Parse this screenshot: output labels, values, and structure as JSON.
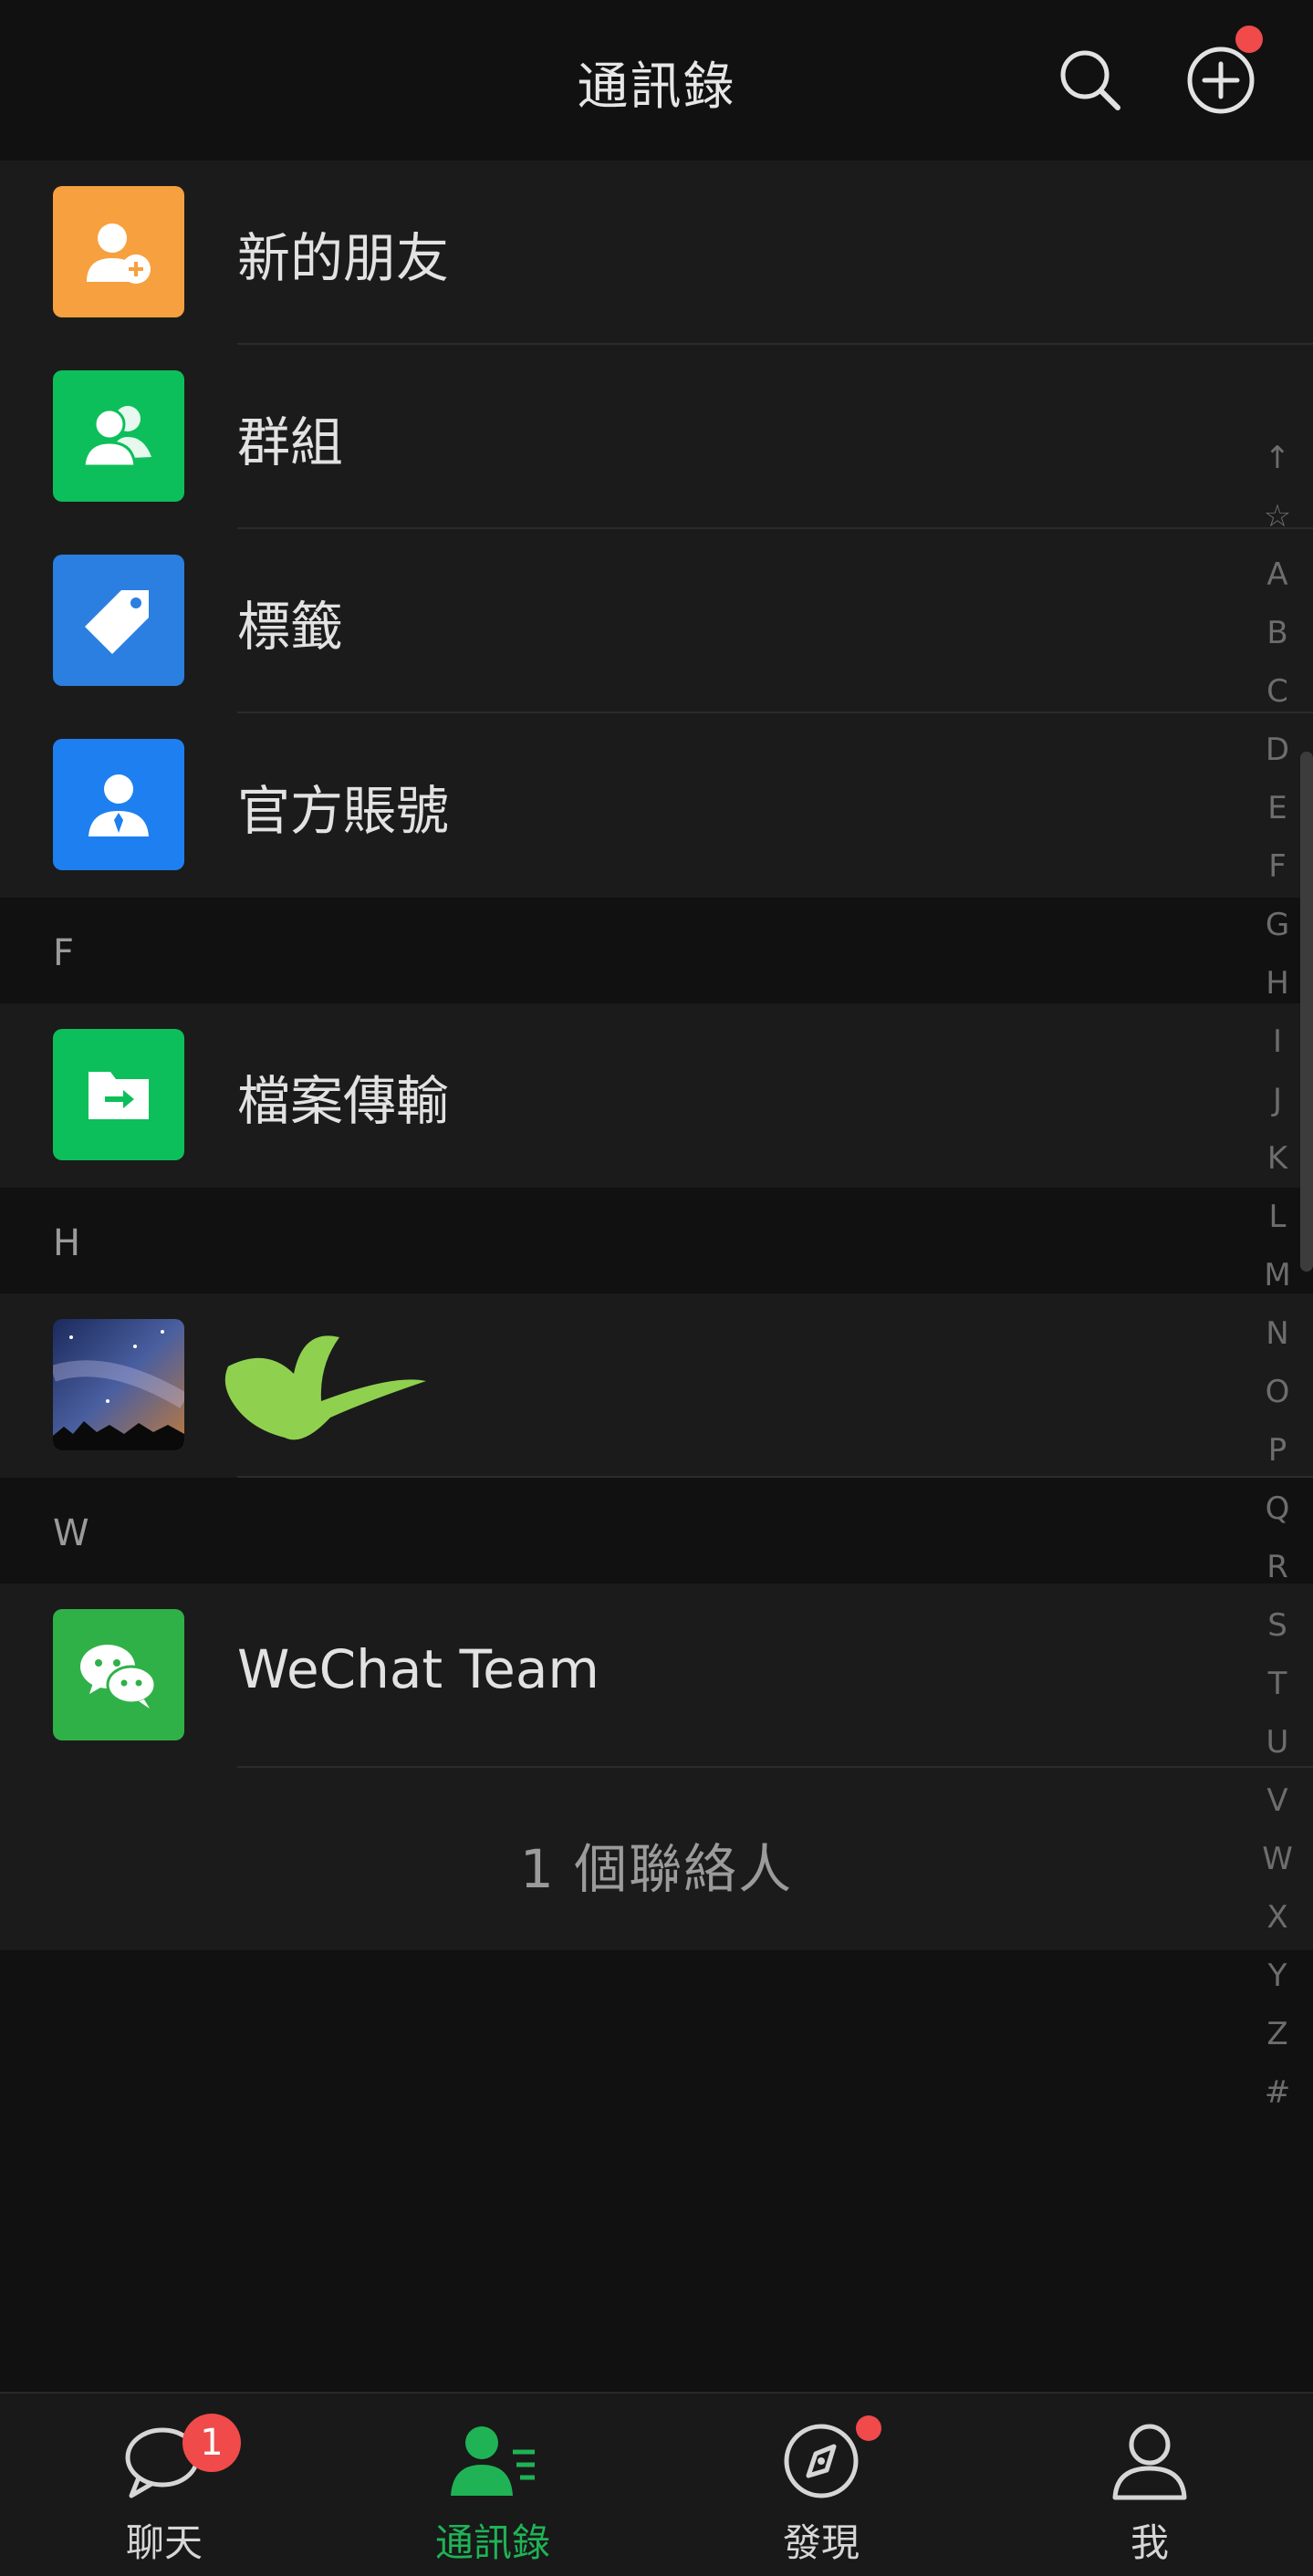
{
  "header": {
    "title": "通訊錄"
  },
  "colors": {
    "background": "#111111",
    "row_background": "#1b1b1b",
    "accent_green": "#1fb356",
    "badge_red": "#f04a4a",
    "new_friends_icon": "#f7a03f",
    "groups_icon": "#0dbf5a",
    "tags_icon": "#2b7fe0",
    "official_icon": "#1e7ff0",
    "file_transfer_icon": "#0dbf5a",
    "wechat_team_icon": "#2fb148"
  },
  "top_items": [
    {
      "label": "新的朋友",
      "icon": "add-friend-icon"
    },
    {
      "label": "群組",
      "icon": "group-icon"
    },
    {
      "label": "標籤",
      "icon": "tag-icon"
    },
    {
      "label": "官方賬號",
      "icon": "official-account-icon"
    }
  ],
  "sections": [
    {
      "letter": "F",
      "items": [
        {
          "label": "檔案傳輸",
          "icon": "file-transfer-icon"
        }
      ]
    },
    {
      "letter": "H",
      "items": [
        {
          "label": "",
          "icon": "avatar-starry-sky"
        }
      ]
    },
    {
      "letter": "W",
      "items": [
        {
          "label": "WeChat Team",
          "icon": "wechat-icon"
        }
      ]
    }
  ],
  "contact_count": "1 個聯絡人",
  "alpha_index": [
    "↑",
    "☆",
    "A",
    "B",
    "C",
    "D",
    "E",
    "F",
    "G",
    "H",
    "I",
    "J",
    "K",
    "L",
    "M",
    "N",
    "O",
    "P",
    "Q",
    "R",
    "S",
    "T",
    "U",
    "V",
    "W",
    "X",
    "Y",
    "Z",
    "#"
  ],
  "tabs": [
    {
      "label": "聊天",
      "icon": "chat-bubble-icon",
      "badge": "1"
    },
    {
      "label": "通訊錄",
      "icon": "contacts-icon"
    },
    {
      "label": "發現",
      "icon": "compass-icon"
    },
    {
      "label": "我",
      "icon": "person-icon"
    }
  ]
}
